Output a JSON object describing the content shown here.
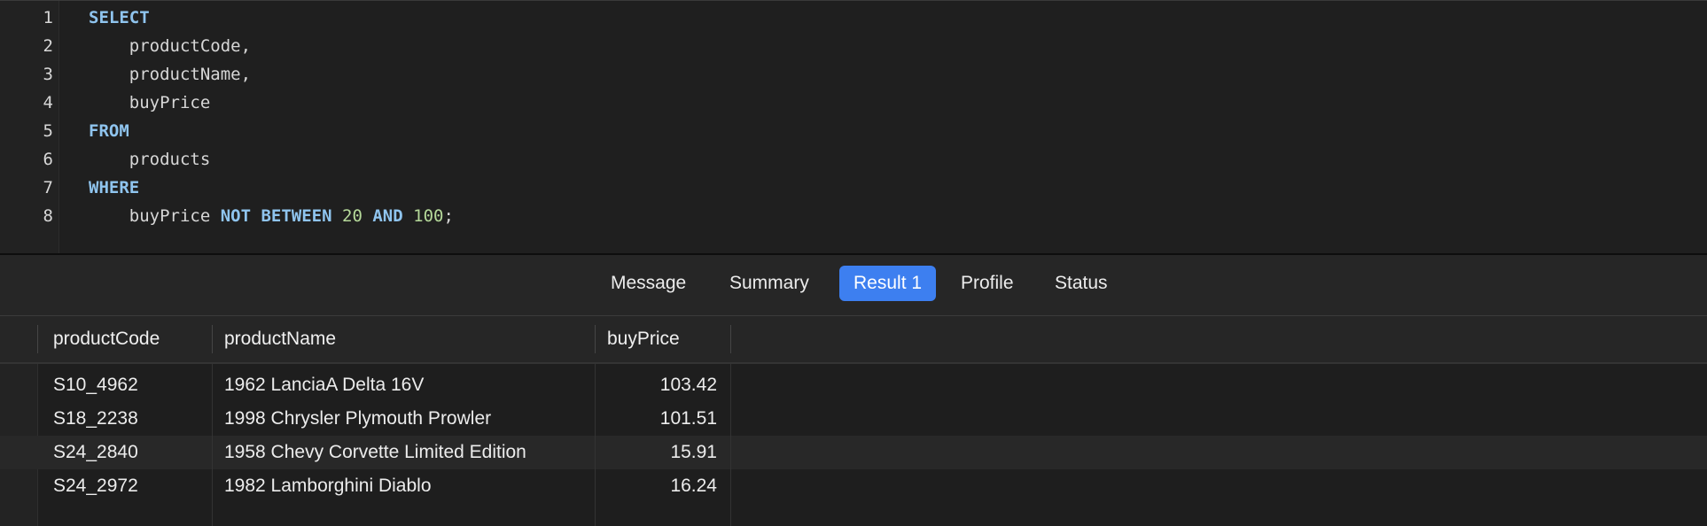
{
  "editor": {
    "lines": [
      {
        "num": "1",
        "tokens": [
          {
            "t": "SELECT",
            "k": "kw"
          }
        ]
      },
      {
        "num": "2",
        "tokens": [
          {
            "t": "    productCode,",
            "k": ""
          }
        ]
      },
      {
        "num": "3",
        "tokens": [
          {
            "t": "    productName,",
            "k": ""
          }
        ]
      },
      {
        "num": "4",
        "tokens": [
          {
            "t": "    buyPrice",
            "k": ""
          }
        ]
      },
      {
        "num": "5",
        "tokens": [
          {
            "t": "FROM",
            "k": "kw"
          }
        ]
      },
      {
        "num": "6",
        "tokens": [
          {
            "t": "    products",
            "k": ""
          }
        ]
      },
      {
        "num": "7",
        "tokens": [
          {
            "t": "WHERE",
            "k": "kw"
          }
        ]
      },
      {
        "num": "8",
        "tokens": [
          {
            "t": "    buyPrice ",
            "k": ""
          },
          {
            "t": "NOT BETWEEN",
            "k": "kw"
          },
          {
            "t": " ",
            "k": ""
          },
          {
            "t": "20",
            "k": "num"
          },
          {
            "t": " ",
            "k": ""
          },
          {
            "t": "AND",
            "k": "kw"
          },
          {
            "t": " ",
            "k": ""
          },
          {
            "t": "100",
            "k": "num"
          },
          {
            "t": ";",
            "k": ""
          }
        ]
      }
    ]
  },
  "tabs": [
    {
      "label": "Message",
      "active": false
    },
    {
      "label": "Summary",
      "active": false
    },
    {
      "label": "Result 1",
      "active": true
    },
    {
      "label": "Profile",
      "active": false
    },
    {
      "label": "Status",
      "active": false
    }
  ],
  "result": {
    "columns": [
      "productCode",
      "productName",
      "buyPrice"
    ],
    "rows": [
      [
        "S10_4962",
        "1962 LanciaA Delta 16V",
        "103.42"
      ],
      [
        "S18_2238",
        "1998 Chrysler Plymouth Prowler",
        "101.51"
      ],
      [
        "S24_2840",
        "1958 Chevy Corvette Limited Edition",
        "15.91"
      ],
      [
        "S24_2972",
        "1982 Lamborghini Diablo",
        "16.24"
      ]
    ]
  },
  "colors": {
    "keyword": "#8fc4ee",
    "number": "#b5d99a",
    "active_tab": "#3d7ff0",
    "background": "#1e1e1e"
  }
}
